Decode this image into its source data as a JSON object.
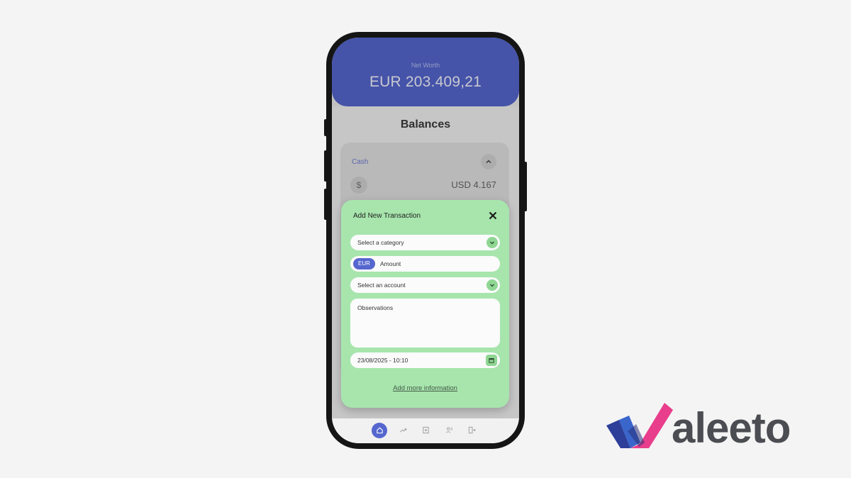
{
  "header": {
    "net_worth_label": "Net Worth",
    "net_worth_value": "EUR 203.409,21"
  },
  "balances": {
    "title": "Balances",
    "cash_section": {
      "label": "Cash",
      "currency_icon": "$",
      "value": "USD 4.167"
    }
  },
  "modal": {
    "title": "Add New Transaction",
    "close_icon": "close-icon",
    "category_placeholder": "Select a category",
    "currency_chip": "EUR",
    "amount_placeholder": "Amount",
    "account_placeholder": "Select an account",
    "observations_placeholder": "Observations",
    "datetime_value": "23/08/2025 - 10:10",
    "more_info_link": "Add more information"
  },
  "bottom_nav": {
    "items": [
      {
        "icon": "home-icon",
        "active": true
      },
      {
        "icon": "trend-icon",
        "active": false
      },
      {
        "icon": "add-document-icon",
        "active": false
      },
      {
        "icon": "users-icon",
        "active": false
      },
      {
        "icon": "exit-icon",
        "active": false
      }
    ]
  },
  "brand": {
    "logo_text": "aleeto",
    "colors": {
      "primary": "#5566cf",
      "accent_pink": "#e83e8c",
      "modal_green": "#a7e5ad",
      "logo_navy": "#2d3f99"
    }
  }
}
